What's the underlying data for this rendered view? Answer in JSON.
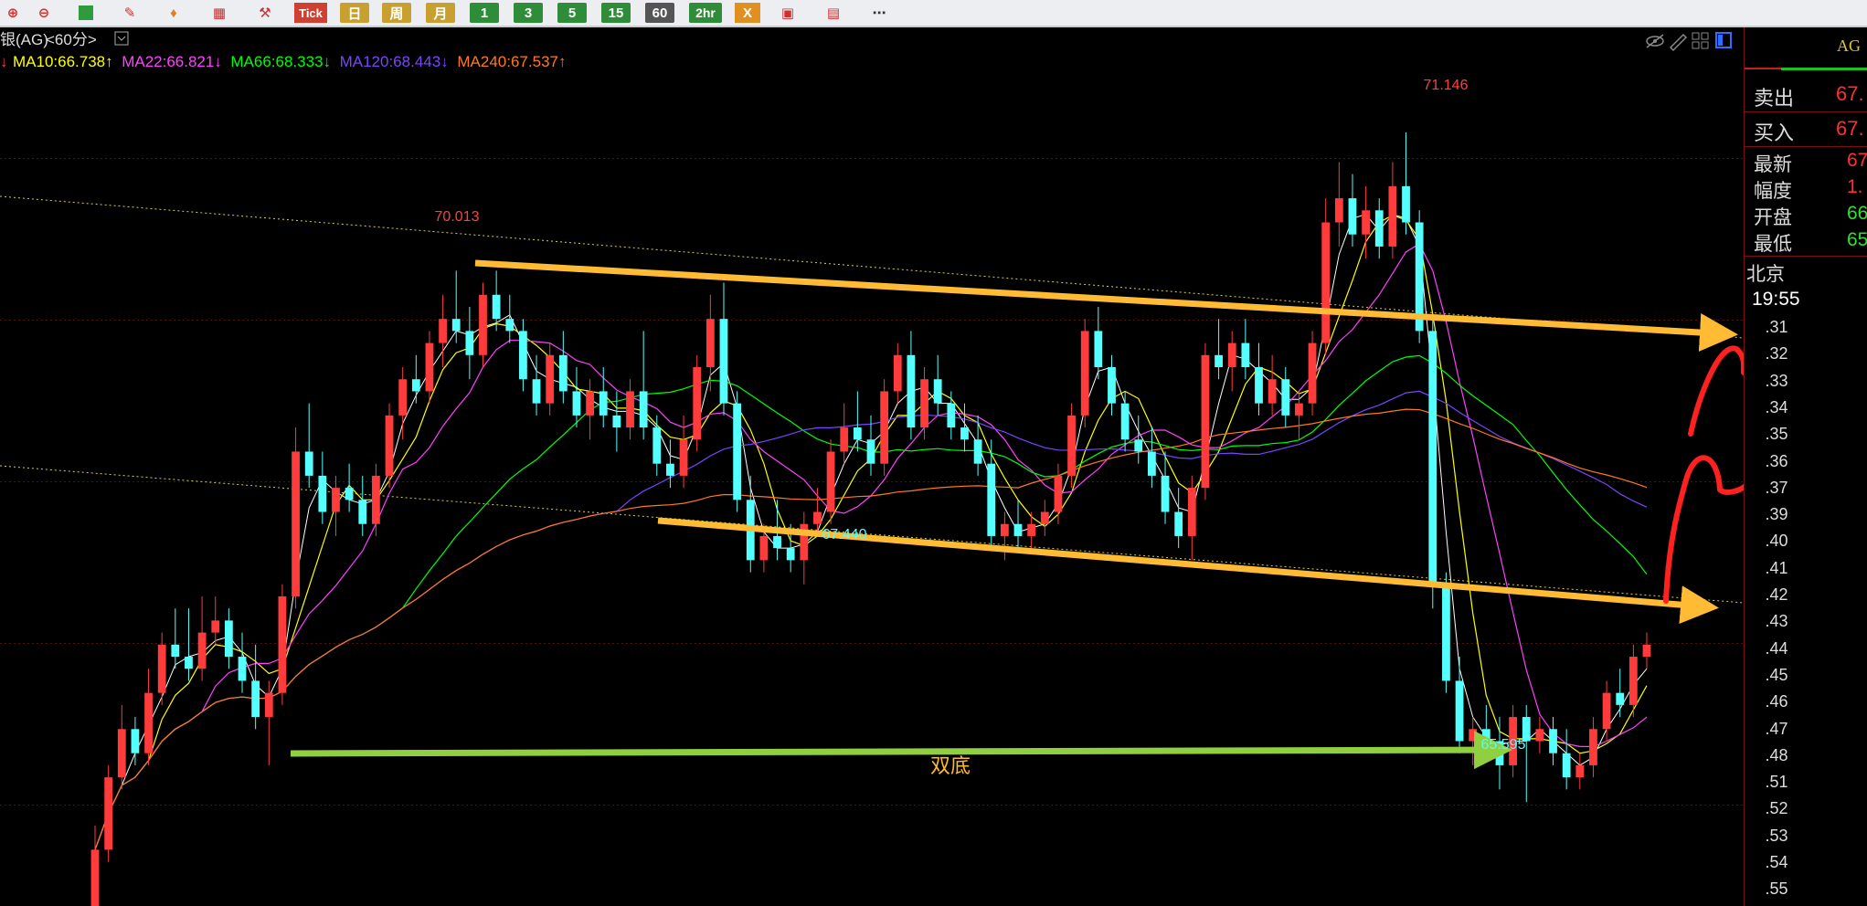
{
  "toolbar": {
    "tick_label": "Tick",
    "day_label": "日",
    "week_label": "周",
    "month_label": "月",
    "periods": [
      "1",
      "3",
      "5",
      "15",
      "60",
      "2hr"
    ],
    "more_label": "⋯",
    "x_label": "X"
  },
  "chart_header": {
    "title": "银(AG)",
    "interval": "<60分>",
    "ma_lines": [
      {
        "text": "MA10:66.738↑",
        "color": "#ffff00"
      },
      {
        "text": "MA22:66.821↓",
        "color": "#ff40ff"
      },
      {
        "text": "MA66:68.333↓",
        "color": "#00ff00"
      },
      {
        "text": "MA120:68.443↓",
        "color": "#7b44ff"
      },
      {
        "text": "MA240:67.537↑",
        "color": "#ff7a1a"
      }
    ]
  },
  "chart_data": {
    "type": "candlestick",
    "title": "银(AG) <60分>",
    "ylim": [
      64.9,
      71.6
    ],
    "annotations": [
      {
        "text": "70.013",
        "value": 70.013,
        "kind": "swing-high"
      },
      {
        "text": "71.146",
        "value": 71.146,
        "kind": "swing-high"
      },
      {
        "text": "67.440",
        "value": 67.44,
        "kind": "swing-low"
      },
      {
        "text": "65.595",
        "value": 65.595,
        "kind": "swing-low"
      },
      {
        "text": "双底",
        "kind": "pattern-label"
      }
    ],
    "candles": [
      {
        "o": 64.7,
        "h": 65.4,
        "l": 64.6,
        "c": 65.2
      },
      {
        "o": 65.2,
        "h": 65.9,
        "l": 65.1,
        "c": 65.8
      },
      {
        "o": 65.8,
        "h": 66.4,
        "l": 65.7,
        "c": 66.2
      },
      {
        "o": 66.2,
        "h": 66.3,
        "l": 65.9,
        "c": 66.0
      },
      {
        "o": 66.0,
        "h": 66.7,
        "l": 65.9,
        "c": 66.5
      },
      {
        "o": 66.5,
        "h": 67.0,
        "l": 66.4,
        "c": 66.9
      },
      {
        "o": 66.9,
        "h": 67.2,
        "l": 66.7,
        "c": 66.8
      },
      {
        "o": 66.8,
        "h": 67.2,
        "l": 66.6,
        "c": 66.7
      },
      {
        "o": 66.7,
        "h": 67.3,
        "l": 66.6,
        "c": 67.0
      },
      {
        "o": 67.0,
        "h": 67.3,
        "l": 66.9,
        "c": 67.1
      },
      {
        "o": 67.1,
        "h": 67.2,
        "l": 66.7,
        "c": 66.8
      },
      {
        "o": 66.8,
        "h": 67.0,
        "l": 66.5,
        "c": 66.6
      },
      {
        "o": 66.6,
        "h": 66.9,
        "l": 66.2,
        "c": 66.3
      },
      {
        "o": 66.3,
        "h": 66.6,
        "l": 65.9,
        "c": 66.5
      },
      {
        "o": 66.5,
        "h": 67.4,
        "l": 66.4,
        "c": 67.3
      },
      {
        "o": 67.3,
        "h": 68.7,
        "l": 67.2,
        "c": 68.5
      },
      {
        "o": 68.5,
        "h": 68.9,
        "l": 68.2,
        "c": 68.3
      },
      {
        "o": 68.3,
        "h": 68.5,
        "l": 67.9,
        "c": 68.0
      },
      {
        "o": 68.0,
        "h": 68.3,
        "l": 67.8,
        "c": 68.2
      },
      {
        "o": 68.2,
        "h": 68.4,
        "l": 68.0,
        "c": 68.1
      },
      {
        "o": 68.1,
        "h": 68.3,
        "l": 67.8,
        "c": 67.9
      },
      {
        "o": 67.9,
        "h": 68.4,
        "l": 67.8,
        "c": 68.3
      },
      {
        "o": 68.3,
        "h": 68.9,
        "l": 68.2,
        "c": 68.8
      },
      {
        "o": 68.8,
        "h": 69.2,
        "l": 68.6,
        "c": 69.1
      },
      {
        "o": 69.1,
        "h": 69.3,
        "l": 68.9,
        "c": 69.0
      },
      {
        "o": 69.0,
        "h": 69.5,
        "l": 68.9,
        "c": 69.4
      },
      {
        "o": 69.4,
        "h": 69.8,
        "l": 69.2,
        "c": 69.6
      },
      {
        "o": 69.6,
        "h": 70.0,
        "l": 69.4,
        "c": 69.5
      },
      {
        "o": 69.5,
        "h": 69.7,
        "l": 69.1,
        "c": 69.3
      },
      {
        "o": 69.3,
        "h": 69.9,
        "l": 69.2,
        "c": 69.8
      },
      {
        "o": 69.8,
        "h": 70.0,
        "l": 69.5,
        "c": 69.6
      },
      {
        "o": 69.6,
        "h": 69.8,
        "l": 69.4,
        "c": 69.5
      },
      {
        "o": 69.5,
        "h": 69.6,
        "l": 69.0,
        "c": 69.1
      },
      {
        "o": 69.1,
        "h": 69.3,
        "l": 68.8,
        "c": 68.9
      },
      {
        "o": 68.9,
        "h": 69.4,
        "l": 68.8,
        "c": 69.3
      },
      {
        "o": 69.3,
        "h": 69.5,
        "l": 68.9,
        "c": 69.0
      },
      {
        "o": 69.0,
        "h": 69.2,
        "l": 68.7,
        "c": 68.8
      },
      {
        "o": 68.8,
        "h": 69.1,
        "l": 68.6,
        "c": 69.0
      },
      {
        "o": 69.0,
        "h": 69.2,
        "l": 68.7,
        "c": 68.8
      },
      {
        "o": 68.8,
        "h": 69.0,
        "l": 68.5,
        "c": 68.7
      },
      {
        "o": 68.7,
        "h": 69.1,
        "l": 68.6,
        "c": 69.0
      },
      {
        "o": 69.0,
        "h": 69.5,
        "l": 68.6,
        "c": 68.7
      },
      {
        "o": 68.7,
        "h": 68.8,
        "l": 68.3,
        "c": 68.4
      },
      {
        "o": 68.4,
        "h": 68.6,
        "l": 68.2,
        "c": 68.3
      },
      {
        "o": 68.3,
        "h": 68.8,
        "l": 68.2,
        "c": 68.6
      },
      {
        "o": 68.6,
        "h": 69.3,
        "l": 68.5,
        "c": 69.2
      },
      {
        "o": 69.2,
        "h": 69.8,
        "l": 69.0,
        "c": 69.6
      },
      {
        "o": 69.6,
        "h": 69.9,
        "l": 68.8,
        "c": 68.9
      },
      {
        "o": 68.9,
        "h": 69.0,
        "l": 68.0,
        "c": 68.1
      },
      {
        "o": 68.1,
        "h": 68.3,
        "l": 67.5,
        "c": 67.6
      },
      {
        "o": 67.6,
        "h": 67.9,
        "l": 67.5,
        "c": 67.8
      },
      {
        "o": 67.8,
        "h": 68.1,
        "l": 67.6,
        "c": 67.7
      },
      {
        "o": 67.7,
        "h": 67.9,
        "l": 67.5,
        "c": 67.6
      },
      {
        "o": 67.6,
        "h": 68.0,
        "l": 67.4,
        "c": 67.9
      },
      {
        "o": 67.9,
        "h": 68.2,
        "l": 67.8,
        "c": 68.0
      },
      {
        "o": 68.0,
        "h": 68.6,
        "l": 67.9,
        "c": 68.5
      },
      {
        "o": 68.5,
        "h": 68.9,
        "l": 68.4,
        "c": 68.7
      },
      {
        "o": 68.7,
        "h": 69.0,
        "l": 68.5,
        "c": 68.6
      },
      {
        "o": 68.6,
        "h": 68.8,
        "l": 68.3,
        "c": 68.4
      },
      {
        "o": 68.4,
        "h": 69.1,
        "l": 68.3,
        "c": 69.0
      },
      {
        "o": 69.0,
        "h": 69.4,
        "l": 68.9,
        "c": 69.3
      },
      {
        "o": 69.3,
        "h": 69.5,
        "l": 68.6,
        "c": 68.7
      },
      {
        "o": 68.7,
        "h": 69.2,
        "l": 68.6,
        "c": 69.1
      },
      {
        "o": 69.1,
        "h": 69.3,
        "l": 68.8,
        "c": 68.9
      },
      {
        "o": 68.9,
        "h": 69.0,
        "l": 68.6,
        "c": 68.7
      },
      {
        "o": 68.7,
        "h": 68.9,
        "l": 68.5,
        "c": 68.6
      },
      {
        "o": 68.6,
        "h": 68.8,
        "l": 68.3,
        "c": 68.4
      },
      {
        "o": 68.4,
        "h": 68.6,
        "l": 67.7,
        "c": 67.8
      },
      {
        "o": 67.8,
        "h": 68.0,
        "l": 67.6,
        "c": 67.9
      },
      {
        "o": 67.9,
        "h": 68.1,
        "l": 67.7,
        "c": 67.8
      },
      {
        "o": 67.8,
        "h": 68.0,
        "l": 67.7,
        "c": 67.9
      },
      {
        "o": 67.9,
        "h": 68.1,
        "l": 67.8,
        "c": 68.0
      },
      {
        "o": 68.0,
        "h": 68.4,
        "l": 67.9,
        "c": 68.3
      },
      {
        "o": 68.3,
        "h": 68.9,
        "l": 68.2,
        "c": 68.8
      },
      {
        "o": 68.8,
        "h": 69.6,
        "l": 68.7,
        "c": 69.5
      },
      {
        "o": 69.5,
        "h": 69.7,
        "l": 69.1,
        "c": 69.2
      },
      {
        "o": 69.2,
        "h": 69.3,
        "l": 68.8,
        "c": 68.9
      },
      {
        "o": 68.9,
        "h": 69.0,
        "l": 68.5,
        "c": 68.6
      },
      {
        "o": 68.6,
        "h": 68.8,
        "l": 68.4,
        "c": 68.5
      },
      {
        "o": 68.5,
        "h": 68.7,
        "l": 68.2,
        "c": 68.3
      },
      {
        "o": 68.3,
        "h": 68.5,
        "l": 67.9,
        "c": 68.0
      },
      {
        "o": 68.0,
        "h": 68.2,
        "l": 67.7,
        "c": 67.8
      },
      {
        "o": 67.8,
        "h": 68.3,
        "l": 67.6,
        "c": 68.2
      },
      {
        "o": 68.2,
        "h": 69.4,
        "l": 68.1,
        "c": 69.3
      },
      {
        "o": 69.3,
        "h": 69.6,
        "l": 69.1,
        "c": 69.2
      },
      {
        "o": 69.2,
        "h": 69.5,
        "l": 69.0,
        "c": 69.4
      },
      {
        "o": 69.4,
        "h": 69.6,
        "l": 69.1,
        "c": 69.2
      },
      {
        "o": 69.2,
        "h": 69.4,
        "l": 68.8,
        "c": 68.9
      },
      {
        "o": 68.9,
        "h": 69.3,
        "l": 68.8,
        "c": 69.1
      },
      {
        "o": 69.1,
        "h": 69.2,
        "l": 68.7,
        "c": 68.8
      },
      {
        "o": 68.8,
        "h": 69.0,
        "l": 68.6,
        "c": 68.9
      },
      {
        "o": 68.9,
        "h": 69.5,
        "l": 68.8,
        "c": 69.4
      },
      {
        "o": 69.4,
        "h": 70.6,
        "l": 69.3,
        "c": 70.4
      },
      {
        "o": 70.4,
        "h": 70.9,
        "l": 70.2,
        "c": 70.6
      },
      {
        "o": 70.6,
        "h": 70.8,
        "l": 70.2,
        "c": 70.3
      },
      {
        "o": 70.3,
        "h": 70.7,
        "l": 70.1,
        "c": 70.5
      },
      {
        "o": 70.5,
        "h": 70.6,
        "l": 70.1,
        "c": 70.2
      },
      {
        "o": 70.2,
        "h": 70.9,
        "l": 70.1,
        "c": 70.7
      },
      {
        "o": 70.7,
        "h": 71.146,
        "l": 70.3,
        "c": 70.4
      },
      {
        "o": 70.4,
        "h": 70.5,
        "l": 69.4,
        "c": 69.5
      },
      {
        "o": 69.5,
        "h": 69.6,
        "l": 67.2,
        "c": 67.4
      },
      {
        "o": 67.4,
        "h": 67.5,
        "l": 66.5,
        "c": 66.6
      },
      {
        "o": 66.6,
        "h": 66.8,
        "l": 66.0,
        "c": 66.1
      },
      {
        "o": 66.1,
        "h": 66.3,
        "l": 65.9,
        "c": 66.2
      },
      {
        "o": 66.2,
        "h": 66.4,
        "l": 66.0,
        "c": 66.1
      },
      {
        "o": 66.1,
        "h": 66.3,
        "l": 65.7,
        "c": 65.9
      },
      {
        "o": 65.9,
        "h": 66.4,
        "l": 65.8,
        "c": 66.3
      },
      {
        "o": 66.3,
        "h": 66.4,
        "l": 65.595,
        "c": 66.1
      },
      {
        "o": 66.1,
        "h": 66.3,
        "l": 66.0,
        "c": 66.2
      },
      {
        "o": 66.2,
        "h": 66.3,
        "l": 65.9,
        "c": 66.0
      },
      {
        "o": 66.0,
        "h": 66.2,
        "l": 65.7,
        "c": 65.8
      },
      {
        "o": 65.8,
        "h": 66.0,
        "l": 65.7,
        "c": 65.9
      },
      {
        "o": 65.9,
        "h": 66.3,
        "l": 65.8,
        "c": 66.2
      },
      {
        "o": 66.2,
        "h": 66.6,
        "l": 66.1,
        "c": 66.5
      },
      {
        "o": 66.5,
        "h": 66.7,
        "l": 66.3,
        "c": 66.4
      },
      {
        "o": 66.4,
        "h": 66.9,
        "l": 66.3,
        "c": 66.8
      },
      {
        "o": 66.8,
        "h": 67.0,
        "l": 66.7,
        "c": 66.9
      }
    ],
    "y_ticks": [
      ".31",
      ".32",
      ".33",
      ".34",
      ".35",
      ".36",
      ".37",
      ".39",
      ".40",
      ".41",
      ".42",
      ".43",
      ".44",
      ".45",
      ".46",
      ".47",
      ".48",
      ".51",
      ".52",
      ".53",
      ".54",
      ".55"
    ]
  },
  "quote_panel": {
    "symbol": "AG",
    "sell_label": "卖出",
    "sell_value": "67.",
    "buy_label": "买入",
    "buy_value": "67.",
    "latest_label": "最新",
    "latest_value": "67",
    "change_label": "幅度",
    "change_value": "1.",
    "open_label": "开盘",
    "open_value": "66",
    "low_label": "最低",
    "low_value": "65",
    "city": "北京",
    "time": "19:55"
  },
  "colors": {
    "up": "#ff3b3b",
    "down": "#54ffff",
    "trend": "#ffbb33",
    "support": "#90d040",
    "annot_label": "#ffbb33"
  }
}
